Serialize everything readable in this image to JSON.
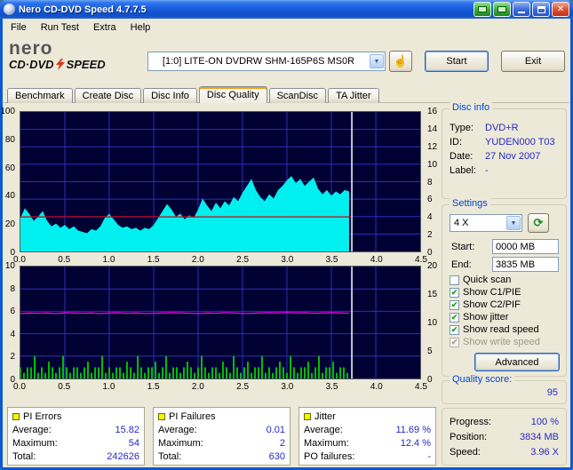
{
  "window": {
    "title": "Nero CD-DVD Speed 4.7.7.5",
    "menu_items": [
      "File",
      "Run Test",
      "Extra",
      "Help"
    ]
  },
  "header": {
    "logo_top": "nero",
    "logo_bottom_left": "CD·DVD",
    "logo_bottom_right": "SPEED",
    "drive_selector": "[1:0]  LITE-ON DVDRW SHM-165P6S MS0R",
    "start_button": "Start",
    "exit_button": "Exit"
  },
  "tabs": {
    "items": [
      "Benchmark",
      "Create Disc",
      "Disc Info",
      "Disc Quality",
      "ScanDisc",
      "TA Jitter"
    ],
    "active": "Disc Quality"
  },
  "disc_info": {
    "title": "Disc info",
    "rows": [
      {
        "label": "Type:",
        "value": "DVD+R"
      },
      {
        "label": "ID:",
        "value": "YUDEN000 T03"
      },
      {
        "label": "Date:",
        "value": "27 Nov 2007"
      },
      {
        "label": "Label:",
        "value": "-"
      }
    ]
  },
  "settings": {
    "title": "Settings",
    "speed_value": "4 X",
    "start_label": "Start:",
    "start_value": "0000 MB",
    "end_label": "End:",
    "end_value": "3835 MB",
    "checkboxes": [
      {
        "label": "Quick scan",
        "checked": false,
        "disabled": false
      },
      {
        "label": "Show C1/PIE",
        "checked": true,
        "disabled": false
      },
      {
        "label": "Show C2/PIF",
        "checked": true,
        "disabled": false
      },
      {
        "label": "Show jitter",
        "checked": true,
        "disabled": false
      },
      {
        "label": "Show read speed",
        "checked": true,
        "disabled": false
      },
      {
        "label": "Show write speed",
        "checked": true,
        "disabled": true
      }
    ],
    "advanced_button": "Advanced"
  },
  "quality": {
    "label": "Quality score:",
    "value": "95"
  },
  "progress": {
    "rows": [
      {
        "label": "Progress:",
        "value": "100 %"
      },
      {
        "label": "Position:",
        "value": "3834 MB"
      },
      {
        "label": "Speed:",
        "value": "3.96 X"
      }
    ]
  },
  "stats_panels": [
    {
      "title": "PI Errors",
      "swatch": "#F5F500",
      "rows": [
        [
          "Average:",
          "15.82"
        ],
        [
          "Maximum:",
          "54"
        ],
        [
          "Total:",
          "242626"
        ]
      ]
    },
    {
      "title": "PI Failures",
      "swatch": "#F5F500",
      "rows": [
        [
          "Average:",
          "0.01"
        ],
        [
          "Maximum:",
          "2"
        ],
        [
          "Total:",
          "630"
        ]
      ]
    },
    {
      "title": "Jitter",
      "swatch": "#F5F500",
      "rows": [
        [
          "Average:",
          "11.69 %"
        ],
        [
          "Maximum:",
          "12.4 %"
        ],
        [
          "PO failures:",
          "-"
        ]
      ]
    }
  ],
  "chart_data": {
    "x_ticks": [
      "0.0",
      "0.5",
      "1.0",
      "1.5",
      "2.0",
      "2.5",
      "3.0",
      "3.5",
      "4.0",
      "4.5"
    ],
    "x_max": 4.5,
    "scan_end_x": 3.73,
    "plot_bg": "#000033",
    "grid_color": "#2E2EC0",
    "cursor_color": "#FFFFFF",
    "top": {
      "type": "area",
      "left_ticks": [
        100,
        80,
        60,
        40,
        20,
        0
      ],
      "right_ticks": [
        16,
        14,
        12,
        10,
        8,
        6,
        4,
        2,
        0
      ],
      "left_max": 100,
      "right_max": 16,
      "pi_errors": {
        "color": "#00F0F0",
        "step": 0.05,
        "values": [
          24,
          31,
          27,
          22,
          25,
          29,
          22,
          18,
          20,
          17,
          19,
          16,
          18,
          15,
          14,
          13,
          16,
          15,
          18,
          24,
          27,
          23,
          19,
          17,
          18,
          16,
          17,
          15,
          17,
          16,
          19,
          24,
          29,
          34,
          30,
          25,
          27,
          23,
          26,
          24,
          30,
          38,
          33,
          29,
          35,
          31,
          36,
          33,
          39,
          36,
          42,
          47,
          52,
          44,
          39,
          36,
          41,
          38,
          44,
          47,
          51,
          54,
          49,
          52,
          47,
          50,
          53,
          45,
          41,
          44,
          40,
          43,
          41,
          44,
          43
        ]
      },
      "read_speed": {
        "color": "#D00000",
        "value": 3.96
      }
    },
    "bottom": {
      "type": "bar",
      "left_ticks": [
        10,
        8,
        6,
        4,
        2,
        0
      ],
      "right_ticks": [
        20,
        15,
        10,
        5,
        0
      ],
      "left_max": 10,
      "right_max": 20,
      "pi_failures": {
        "color": "#00C000",
        "step": 0.04,
        "values": [
          1,
          0.5,
          1,
          1,
          2,
          0.5,
          1,
          0.5,
          1.5,
          1,
          0.5,
          1,
          2,
          1,
          0.5,
          1,
          1,
          0.5,
          1,
          1.5,
          0.5,
          1,
          1,
          2,
          0.5,
          1,
          0.5,
          1,
          1,
          0.5,
          1.5,
          1,
          0.5,
          2,
          1,
          0.5,
          1,
          1,
          1.5,
          0.5,
          1,
          2,
          0.5,
          1,
          1,
          0.5,
          1,
          1.5,
          1,
          0.5,
          1,
          2,
          1,
          0.5,
          1,
          1,
          0.5,
          1.5,
          1,
          0.5,
          2,
          1,
          0.5,
          1,
          1.5,
          0.5,
          1,
          1,
          2,
          0.5,
          1,
          0.5,
          1,
          1.5,
          1,
          0.5,
          2,
          1,
          0.5,
          1,
          1,
          1.5,
          0.5,
          1,
          2,
          0.5,
          1,
          1,
          1.5,
          0.5,
          1,
          1,
          0.5
        ]
      },
      "jitter": {
        "color": "#FF00FF",
        "step": 0.1,
        "values": [
          11.6,
          11.7,
          11.65,
          11.7,
          11.6,
          11.75,
          11.7,
          11.65,
          11.7,
          11.6,
          11.7,
          11.75,
          11.65,
          11.7,
          11.6,
          11.65,
          11.7,
          11.75,
          11.7,
          11.65,
          11.6,
          11.7,
          11.65,
          11.75,
          11.7,
          11.6,
          11.65,
          11.7,
          11.75,
          11.7,
          11.8,
          11.7,
          11.75,
          11.65,
          11.7,
          11.75,
          11.7,
          11.65
        ]
      }
    }
  }
}
